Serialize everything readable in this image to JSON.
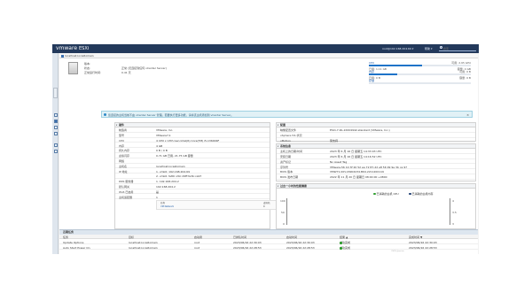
{
  "topbar": {
    "logo": "vmware",
    "product": "ESXi",
    "user": "root@192.168.204.69 ▾",
    "help": "帮助 ▾",
    "search_placeholder": "搜索"
  },
  "path": {
    "host": "localhost.localdomain"
  },
  "host_info": {
    "version_label": "版本:",
    "version_value": "",
    "state_label": "状态:",
    "state_value": "正常 (无连接到任何 vCenter Server)",
    "uptime_label": "正常运行时间:",
    "uptime_value": "0.41 天"
  },
  "resources": {
    "cpu": {
      "label": "CPU",
      "free": "可用: 2.95 GHz",
      "used": "已用: 1.11 GB",
      "capacity": "容量: 4 GB",
      "usage": 0.52
    },
    "memory": {
      "label": "内存",
      "free": "可用: 0 B",
      "used": "已用: 0 B",
      "capacity": "容量: 0 B",
      "usage": 0.28
    },
    "storage": {
      "label": "存储",
      "free": "",
      "used": "",
      "capacity": "",
      "usage": 0
    }
  },
  "alert": {
    "text": "您连接的主机当前不由 vCenter Server 管理。若要执行更多功能，请将该主机添加到 vCenter Server。"
  },
  "hardware": {
    "title": "硬件",
    "rows": [
      {
        "key": "制造商",
        "value": "VMware, Inc."
      },
      {
        "key": "型号",
        "value": "VMware7,1"
      },
      {
        "key": "CPU",
        "value": "4 CPU x 13th Gen Intel(R) Core(TM) i5-13600KF"
      },
      {
        "key": "内存",
        "value": "4 GB"
      },
      {
        "key": "持久内存",
        "value": "0 B / 0 B"
      },
      {
        "key": "虚拟闪存",
        "value": "0.71 GB 已用, 21.75 GB 容量"
      },
      {
        "key": "网络",
        "value": ""
      },
      {
        "key": "主机名",
        "value": "localhost.localdomain"
      },
      {
        "key": "IP 地址",
        "value": "1. vmk0: 192.168.204.69"
      },
      {
        "key": "",
        "value": "2. vmk0: fe80::20c:29ff:fe3b:ca97"
      },
      {
        "key": "DNS 服务器",
        "value": "1. 192.168.204.2"
      },
      {
        "key": "默认网关",
        "value": "192.168.204.2"
      },
      {
        "key": "IPv6 已启用",
        "value": "是"
      },
      {
        "key": "主机适配器",
        "value": "1"
      }
    ],
    "subtable": {
      "col1": "名称",
      "col2": "虚拟机",
      "row_name": "VM Network",
      "row_count": "0"
    }
  },
  "configuration": {
    "title": "配置",
    "rows": [
      {
        "key": "映像配置文件",
        "value": "ESXi-7.0b-16324942-standard (VMware, Inc.)"
      },
      {
        "key": "vSphere HA 状况",
        "value": ""
      },
      {
        "key": "vMotion",
        "value": "受支持"
      }
    ]
  },
  "system_info": {
    "title": "系统信息",
    "rows": [
      {
        "key": "主机上的日期/时间",
        "value": "2023 年 6 月 16 日 星期五 14:33:03 UTC"
      },
      {
        "key": "安装日期",
        "value": "2023 年 6 月 16 日 星期五 14:16:52 UTC"
      },
      {
        "key": "资产标记",
        "value": "No Asset Tag"
      },
      {
        "key": "序列号",
        "value": "VMware-56 4d 3f 20 52 ea 72 87-2d e8 56 99 9e 3b ca 97"
      },
      {
        "key": "BIOS 版本",
        "value": "VMW71.00V.20904234.B64.2211200119"
      },
      {
        "key": "BIOS 发布日期",
        "value": "2022 年 11 月 20 日 星期日 08:00:00 +0800"
      }
    ]
  },
  "performance": {
    "title": "过去一小时的性能摘要",
    "legend_cpu": "已消耗的主机 CPU",
    "legend_mem": "已消耗的主机内存",
    "left_ticks": [
      "100",
      "50",
      "0"
    ],
    "right_ticks": [
      "4",
      "3.5",
      "3"
    ]
  },
  "tasks": {
    "title": "近期任务",
    "columns": [
      "任务",
      "目标",
      "启动者",
      "已排队时间",
      "启动时间",
      "结果 ▲",
      "完成时间 ▼"
    ],
    "rows": [
      {
        "task": "Update Options",
        "target": "localhost.localdomain",
        "initiator": "root",
        "queued": "2023/06/16 22:30:03",
        "started": "2023/06/16 22:30:03",
        "result": "成功完成",
        "completed": "2023/06/16 22:30:03"
      },
      {
        "task": "Auto Start Power On",
        "target": "localhost.localdomain",
        "initiator": "root",
        "queued": "2023/06/16 22:28:53",
        "started": "2023/06/16 22:28:53",
        "result": "成功完成",
        "completed": "2023/06/16 22:28:53"
      }
    ]
  },
  "colors": {
    "topbar": "#23395b",
    "accent": "#1e73c8",
    "success": "#2e9e2e",
    "alert_bg": "#e1f1f6"
  },
  "watermark": "CSDN @weixin"
}
